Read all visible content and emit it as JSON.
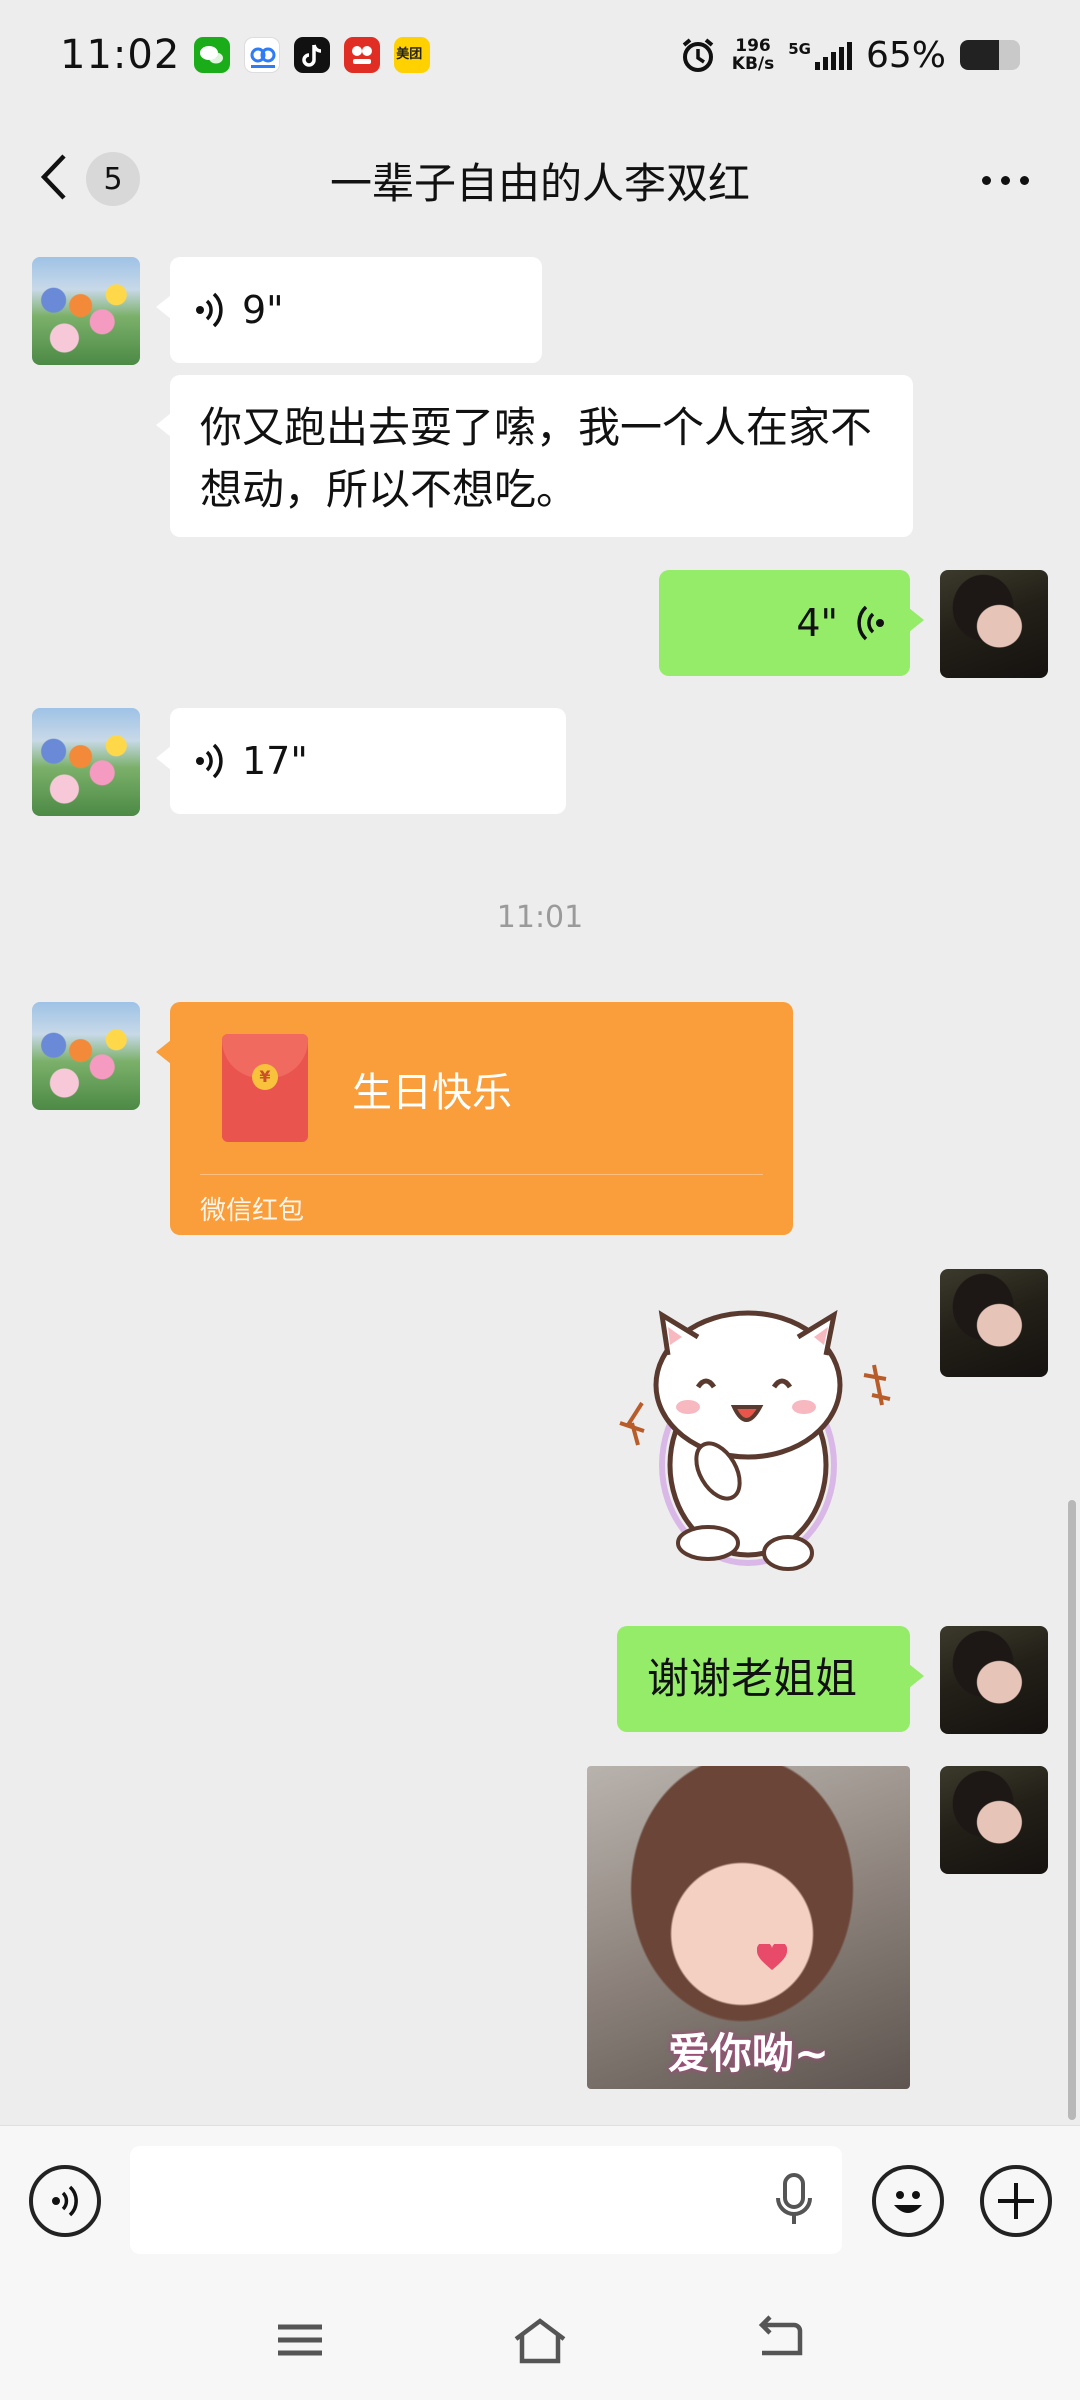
{
  "status_bar": {
    "time": "11:02",
    "net_speed_value": "196",
    "net_speed_unit": "KB/s",
    "network": "5G",
    "battery_percent": "65%",
    "battery_level": 0.65,
    "notification_icons": [
      "wechat-icon",
      "baidu-netdisk-icon",
      "tiktok-icon",
      "pinduoduo-icon",
      "meituan-icon"
    ],
    "meituan_label": "美团"
  },
  "header": {
    "unread_count": "5",
    "title": "一辈子自由的人李双红"
  },
  "messages": {
    "m1_voice": "9\"",
    "m2_text": "你又跑出去耍了嗦，我一个人在家不想动，所以不想吃。",
    "m3_voice": "4\"",
    "m4_voice": "17\"",
    "timestamp": "11:01",
    "red_packet_title": "生日快乐",
    "red_packet_label": "微信红包",
    "red_packet_symbol": "¥",
    "m6_text": "谢谢老姐姐",
    "sticker_caption": "爱你呦~"
  },
  "input": {
    "placeholder": ""
  },
  "colors": {
    "background": "#ededed",
    "incoming_bubble": "#ffffff",
    "outgoing_bubble": "#95ec69",
    "red_packet": "#fa9d3b",
    "timestamp": "#9a9a9a"
  }
}
